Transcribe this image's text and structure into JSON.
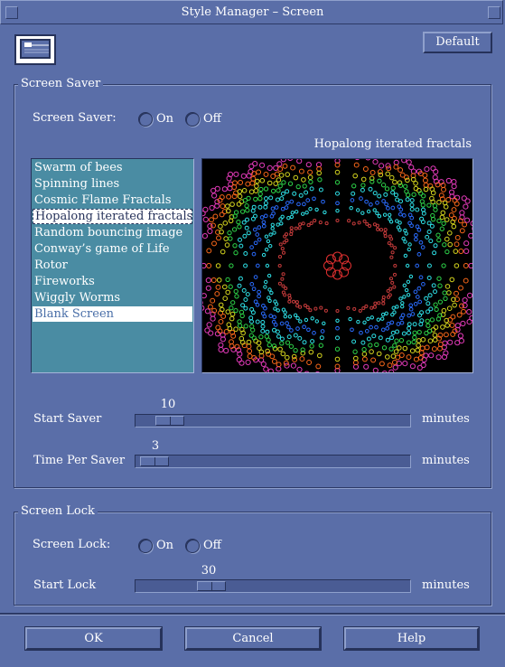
{
  "window": {
    "title": "Style Manager – Screen"
  },
  "header": {
    "default_label": "Default",
    "icon": "screen-monitor-icon"
  },
  "screen_saver": {
    "group_label": "Screen Saver",
    "toggle_label": "Screen Saver:",
    "on_label": "On",
    "off_label": "Off",
    "preview_title": "Hopalong iterated fractals",
    "items": [
      {
        "label": "Swarm of bees"
      },
      {
        "label": "Spinning lines"
      },
      {
        "label": "Cosmic Flame Fractals"
      },
      {
        "label": "Hopalong iterated fractals"
      },
      {
        "label": "Random bouncing image"
      },
      {
        "label": "Conway’s game of Life"
      },
      {
        "label": "Rotor"
      },
      {
        "label": "Fireworks"
      },
      {
        "label": "Wiggly Worms"
      },
      {
        "label": "Blank Screen"
      }
    ],
    "focused_index": 3,
    "selected_index": 9,
    "start_saver": {
      "label": "Start Saver",
      "value": "10",
      "unit": "minutes",
      "fraction": 0.08
    },
    "time_per_saver": {
      "label": "Time Per Saver",
      "value": "3",
      "unit": "minutes",
      "fraction": 0.02
    }
  },
  "screen_lock": {
    "group_label": "Screen Lock",
    "toggle_label": "Screen Lock:",
    "on_label": "On",
    "off_label": "Off",
    "start_lock": {
      "label": "Start Lock",
      "value": "30",
      "unit": "minutes",
      "fraction": 0.25
    }
  },
  "footer": {
    "ok_label": "OK",
    "cancel_label": "Cancel",
    "help_label": "Help"
  },
  "colors": {
    "background": "#5a6ea8",
    "list_background": "#4a8ca3",
    "trough": "#4a5c94"
  }
}
